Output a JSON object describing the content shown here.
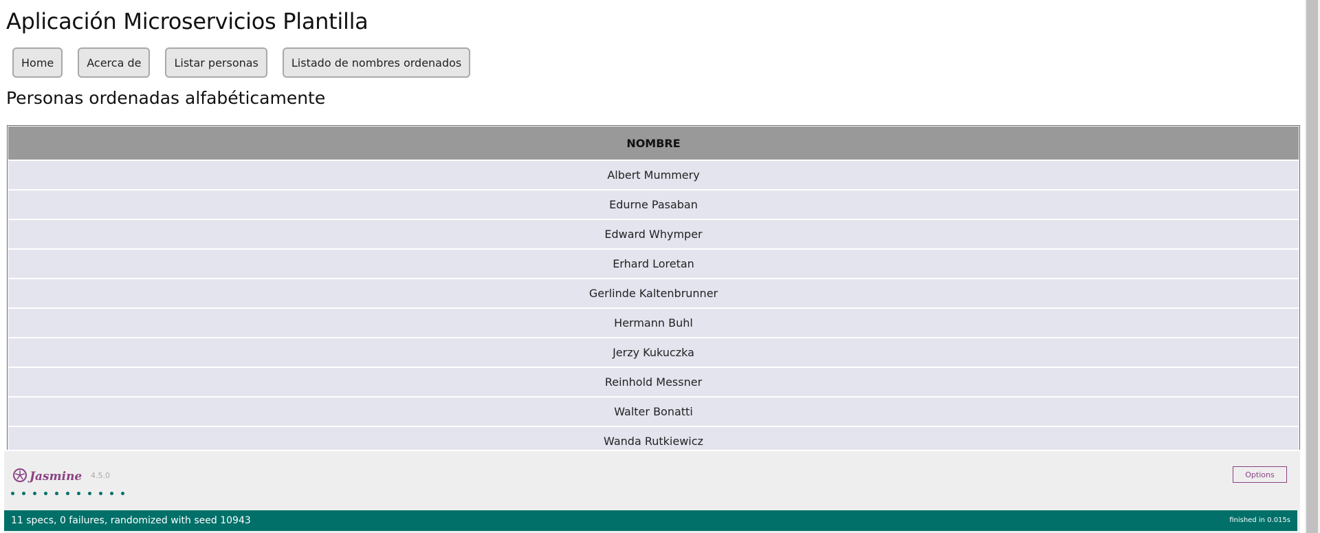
{
  "header": {
    "app_title": "Aplicación Microservicios Plantilla"
  },
  "nav": {
    "items": [
      {
        "label": "Home"
      },
      {
        "label": "Acerca de"
      },
      {
        "label": "Listar personas"
      },
      {
        "label": "Listado de nombres ordenados"
      }
    ]
  },
  "main": {
    "section_title": "Personas ordenadas alfabéticamente",
    "table": {
      "columns": [
        "NOMBRE"
      ],
      "rows": [
        "Albert Mummery",
        "Edurne Pasaban",
        "Edward Whymper",
        "Erhard Loretan",
        "Gerlinde Kaltenbrunner",
        "Hermann Buhl",
        "Jerzy Kukuczka",
        "Reinhold Messner",
        "Walter Bonatti",
        "Wanda Rutkiewicz"
      ]
    }
  },
  "jasmine": {
    "logo_text": "Jasmine",
    "logo_icon": "jasmine-flower-icon",
    "version": "4.5.0",
    "options_label": "Options",
    "spec_dots": 11,
    "summary": "11 specs, 0 failures, randomized with seed 10943",
    "duration": "finished in 0.015s",
    "colors": {
      "brand": "#8a4182",
      "passed": "#007069"
    }
  },
  "colors": {
    "table_header": "#999999",
    "table_row": "#e3e4ee",
    "nav_button": "#e6e6e6"
  }
}
